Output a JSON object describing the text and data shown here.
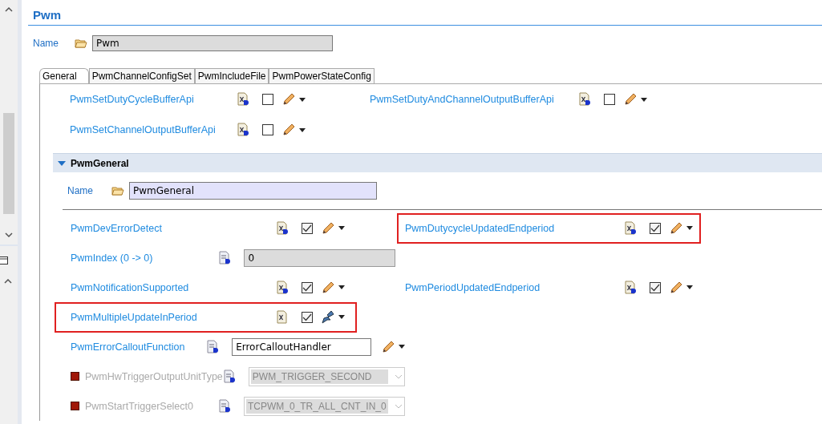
{
  "editor": {
    "title": "Pwm",
    "name_label": "Name",
    "name_value": "Pwm"
  },
  "tabs": [
    {
      "label": "General",
      "selected": true
    },
    {
      "label": "PwmChannelConfigSet",
      "selected": false
    },
    {
      "label": "PwmIncludeFile",
      "selected": false
    },
    {
      "label": "PwmPowerStateConfig",
      "selected": false
    }
  ],
  "top_rows": [
    [
      {
        "label": "PwmSetDutyCycleBufferApi",
        "kind": "boolean",
        "checked": false,
        "user_defined": false,
        "highlighted": false
      },
      {
        "label": "PwmSetDutyAndChannelOutputBufferApi",
        "kind": "boolean",
        "checked": false,
        "user_defined": false,
        "highlighted": false
      }
    ],
    [
      {
        "label": "PwmSetChannelOutputBufferApi",
        "kind": "boolean",
        "checked": false,
        "user_defined": false,
        "highlighted": false
      }
    ]
  ],
  "section": {
    "title": "PwmGeneral",
    "expanded": true,
    "name_label": "Name",
    "name_value": "PwmGeneral",
    "rows": [
      [
        {
          "label": "PwmDevErrorDetect",
          "kind": "boolean",
          "checked": true,
          "user_defined": false,
          "highlighted": false
        },
        {
          "label": "PwmDutycycleUpdatedEndperiod",
          "kind": "boolean",
          "checked": true,
          "user_defined": false,
          "highlighted": true
        }
      ],
      [
        {
          "label": "PwmIndex (0 -> 0)",
          "kind": "number",
          "value": "0",
          "highlighted": false
        }
      ],
      [
        {
          "label": "PwmNotificationSupported",
          "kind": "boolean",
          "checked": true,
          "user_defined": false,
          "highlighted": false
        },
        {
          "label": "PwmPeriodUpdatedEndperiod",
          "kind": "boolean",
          "checked": true,
          "user_defined": false,
          "highlighted": false
        }
      ],
      [
        {
          "label": "PwmMultipleUpdateInPeriod",
          "kind": "boolean",
          "checked": true,
          "user_defined": true,
          "highlighted": true
        }
      ],
      [
        {
          "label": "PwmErrorCalloutFunction",
          "kind": "text",
          "value": "ErrorCalloutHandler",
          "highlighted": false
        }
      ],
      [
        {
          "label": "PwmHwTriggerOutputUnitType",
          "kind": "enum",
          "value": "PWM_TRIGGER_SECOND",
          "highlighted": false
        }
      ],
      [
        {
          "label": "PwmStartTriggerSelect0",
          "kind": "enum",
          "value": "TCPWM_0_TR_ALL_CNT_IN_0",
          "highlighted": false
        }
      ]
    ]
  }
}
